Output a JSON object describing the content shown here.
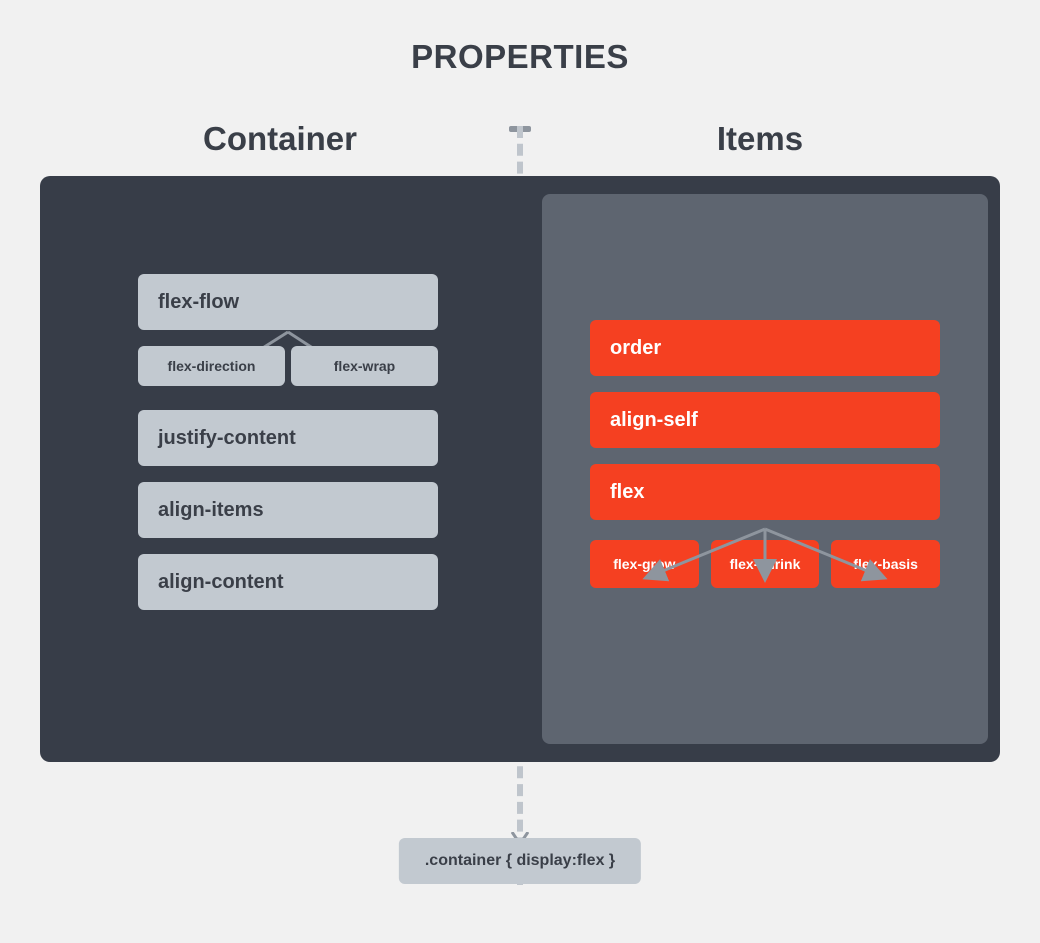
{
  "title": "PROPERTIES",
  "left": {
    "heading": "Container",
    "flex_flow": "flex-flow",
    "flex_direction": "flex-direction",
    "flex_wrap": "flex-wrap",
    "justify_content": "justify-content",
    "align_items": "align-items",
    "align_content": "align-content"
  },
  "right": {
    "heading": "Items",
    "order": "order",
    "align_self": "align-self",
    "flex": "flex",
    "flex_grow": "flex-grow",
    "flex_shrink": "flex-shrink",
    "flex_basis": "flex-basis"
  },
  "caption": ".container { display:flex }"
}
